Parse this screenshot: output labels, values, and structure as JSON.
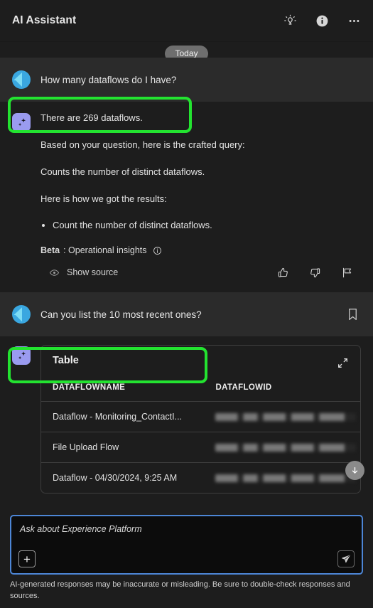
{
  "header": {
    "title": "AI Assistant",
    "actions": [
      {
        "name": "tips-lightbulb-icon",
        "label": "Tips"
      },
      {
        "name": "info-icon",
        "label": "Information"
      },
      {
        "name": "more-options-icon",
        "label": "More options"
      }
    ]
  },
  "conversation": {
    "date_divider": "Today",
    "messages": [
      {
        "role": "user",
        "text": "How many dataflows do I have?",
        "highlighted": true
      },
      {
        "role": "assistant",
        "paragraphs": [
          "There are 269 dataflows.",
          "Based on your question, here is the crafted query:",
          "Counts the number of distinct dataflows.",
          "Here is how we got the results:"
        ],
        "bullets": [
          "Count the number of distinct dataflows."
        ],
        "beta_label": "Beta",
        "beta_text": ": Operational insights",
        "show_source_label": "Show source",
        "feedback": [
          "thumbs-up-icon",
          "thumbs-down-icon",
          "flag-icon"
        ]
      },
      {
        "role": "user",
        "text": "Can you list the 10 most recent ones?",
        "highlighted": true,
        "bookmark": "bookmark-icon"
      },
      {
        "role": "assistant",
        "table": {
          "title": "Table",
          "columns": [
            "DATAFLOWNAME",
            "DATAFLOWID"
          ],
          "rows": [
            {
              "DATAFLOWNAME": "Dataflow - Monitoring_ContactI...",
              "DATAFLOWID": ""
            },
            {
              "DATAFLOWNAME": "File Upload Flow",
              "DATAFLOWID": ""
            },
            {
              "DATAFLOWNAME": "Dataflow - 04/30/2024, 9:25 AM",
              "DATAFLOWID": ""
            }
          ]
        }
      }
    ]
  },
  "composer": {
    "placeholder": "Ask about Experience Platform",
    "add_label": "+",
    "send_name": "send-icon"
  },
  "disclaimer": "AI-generated responses may be inaccurate or misleading. Be sure to double-check responses and sources.",
  "colors": {
    "background": "#1d1d1d",
    "user_band": "#2b2b2b",
    "highlight_green": "#23e330",
    "composer_focus_blue": "#4d86d6",
    "ai_badge_purple": "#9a9bf0",
    "avatar_blue": "#3aa7e0"
  }
}
